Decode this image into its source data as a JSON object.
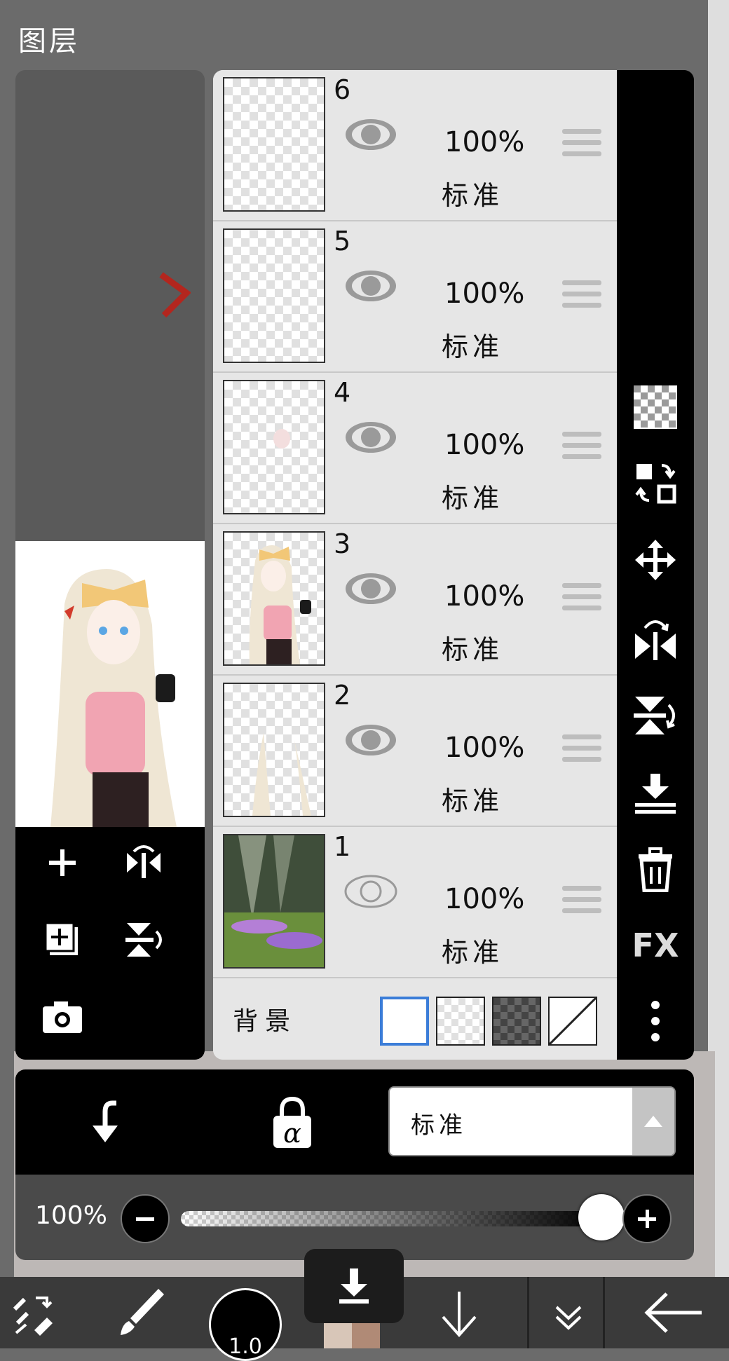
{
  "panel": {
    "title": "图层"
  },
  "layers": [
    {
      "number": "6",
      "opacity": "100%",
      "blend_mode": "标准",
      "visible": true
    },
    {
      "number": "5",
      "opacity": "100%",
      "blend_mode": "标准",
      "visible": true
    },
    {
      "number": "4",
      "opacity": "100%",
      "blend_mode": "标准",
      "visible": true
    },
    {
      "number": "3",
      "opacity": "100%",
      "blend_mode": "标准",
      "visible": true
    },
    {
      "number": "2",
      "opacity": "100%",
      "blend_mode": "标准",
      "visible": true
    },
    {
      "number": "1",
      "opacity": "100%",
      "blend_mode": "标准",
      "visible": false
    }
  ],
  "background": {
    "label": "背景",
    "options": [
      "white",
      "transparent",
      "dark-checker",
      "none"
    ],
    "selected": "white",
    "selected_color": "#3b7dd8"
  },
  "right_toolbar": {
    "icons": [
      "transparency-checker-icon",
      "swap-layers-icon",
      "move-icon",
      "flip-horizontal-icon",
      "flip-vertical-icon",
      "merge-down-icon",
      "trash-icon",
      "fx-icon",
      "more-options-icon"
    ],
    "fx_label": "FX"
  },
  "preview_tools": {
    "icons": [
      "add-layer-icon",
      "flip-horizontal-icon",
      "duplicate-layer-icon",
      "flip-vertical-icon",
      "camera-icon"
    ]
  },
  "action_bar": {
    "blend_select_value": "标准",
    "icons": [
      "clip-arrow-icon",
      "alpha-lock-icon"
    ]
  },
  "opacity": {
    "label": "100%",
    "value": 100
  },
  "app_toolbar": {
    "brush_size": "1.0",
    "icons": [
      "transform-icon",
      "brush-icon",
      "layer-down-icon",
      "chevron-double-down-icon",
      "back-arrow-icon",
      "download-icon"
    ]
  }
}
